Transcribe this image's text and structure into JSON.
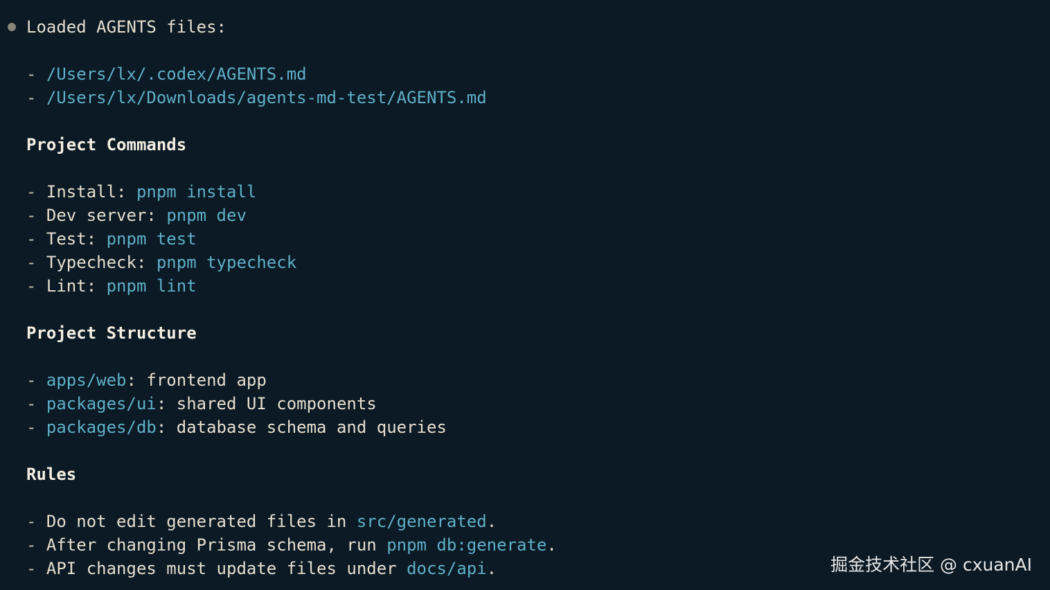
{
  "header": {
    "title": "Loaded AGENTS files:"
  },
  "loaded_files": [
    "/Users/lx/.codex/AGENTS.md",
    "/Users/lx/Downloads/agents-md-test/AGENTS.md"
  ],
  "commands_section": {
    "heading": "Project Commands",
    "items": [
      {
        "label": "Install:",
        "command": "pnpm install"
      },
      {
        "label": "Dev server:",
        "command": "pnpm dev"
      },
      {
        "label": "Test:",
        "command": "pnpm test"
      },
      {
        "label": "Typecheck:",
        "command": "pnpm typecheck"
      },
      {
        "label": "Lint:",
        "command": "pnpm lint"
      }
    ]
  },
  "structure_section": {
    "heading": "Project Structure",
    "items": [
      {
        "path": "apps/web",
        "description": ": frontend app"
      },
      {
        "path": "packages/ui",
        "description": ": shared UI components"
      },
      {
        "path": "packages/db",
        "description": ": database schema and queries"
      }
    ]
  },
  "rules_section": {
    "heading": "Rules",
    "items": [
      {
        "before": "Do not edit generated files in ",
        "code": "src/generated",
        "after": "."
      },
      {
        "before": "After changing Prisma schema, run ",
        "code": "pnpm db:generate",
        "after": "."
      },
      {
        "before": "API changes must update files under ",
        "code": "docs/api",
        "after": "."
      }
    ]
  },
  "bullet_dash": "- ",
  "watermark": "掘金技术社区 @ cxuanAI",
  "colors": {
    "background": "#0b1a25",
    "text": "#e6dfcf",
    "accent": "#5fb0c8"
  }
}
